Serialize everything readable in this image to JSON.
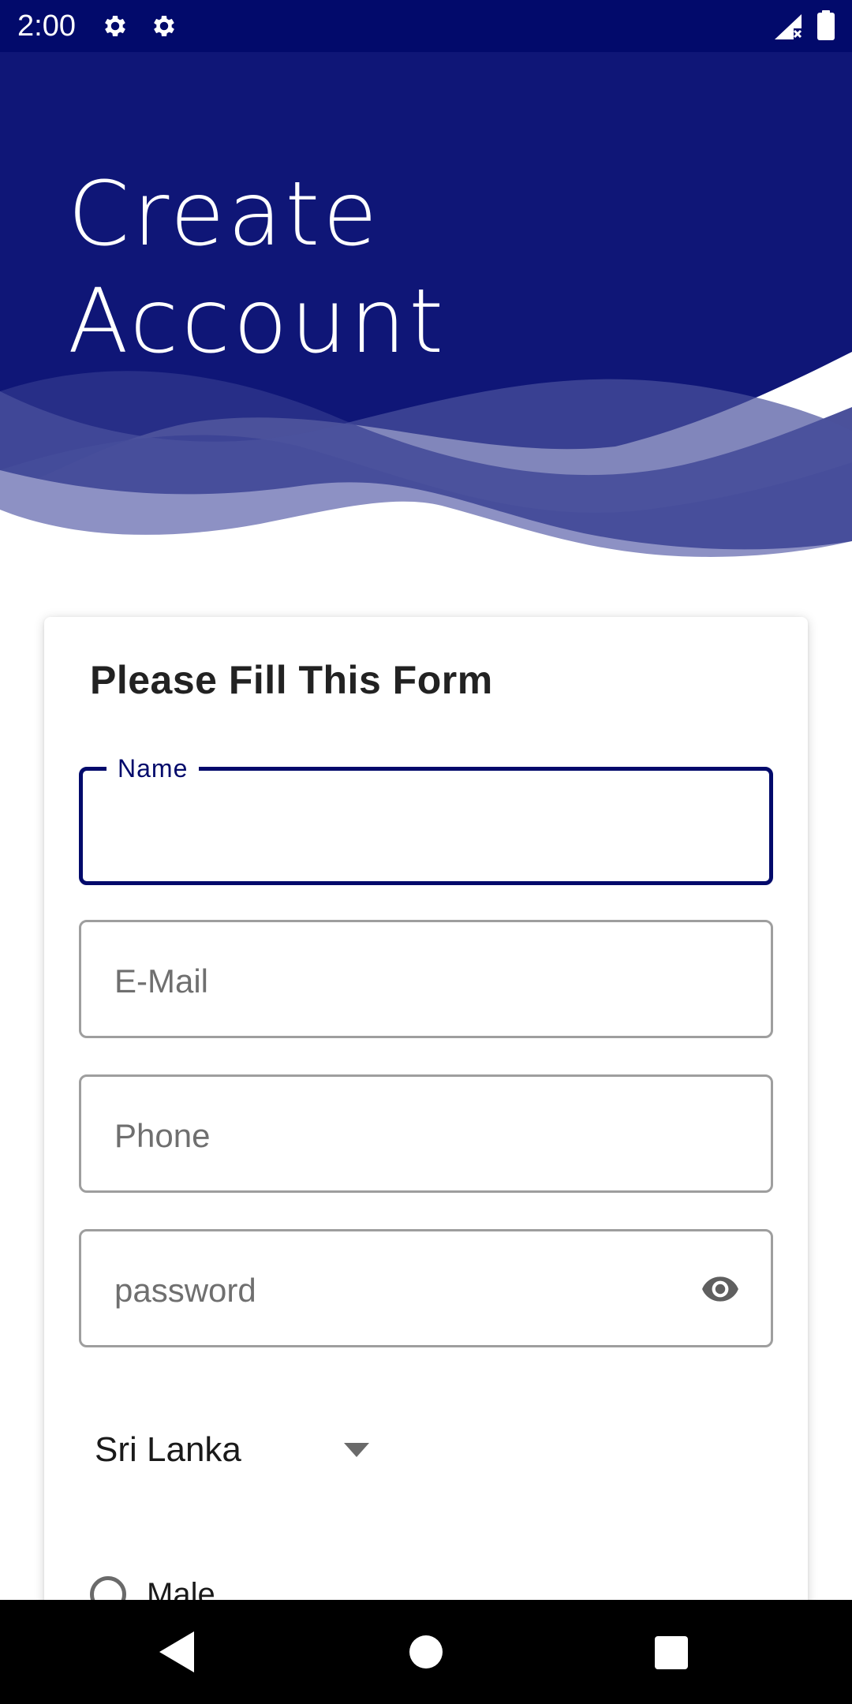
{
  "status_bar": {
    "time": "2:00",
    "icons": [
      "gear-icon",
      "gear-icon",
      "signal-no-sim-icon",
      "battery-icon"
    ],
    "background_color": "#020a6b"
  },
  "header": {
    "title_line1": "Create",
    "title_line2": "Account",
    "background_color": "#0f1677"
  },
  "form": {
    "title": "Please Fill This Form",
    "name_label": "Name",
    "email_placeholder": "E-Mail",
    "phone_placeholder": "Phone",
    "password_placeholder": "password",
    "password_toggle_icon": "eye-icon",
    "country_value": "Sri Lanka",
    "gender_option_male": "Male",
    "accent_color": "#020a6b"
  },
  "nav_bar": {
    "icons": [
      "back-icon",
      "home-icon",
      "recents-icon"
    ]
  }
}
